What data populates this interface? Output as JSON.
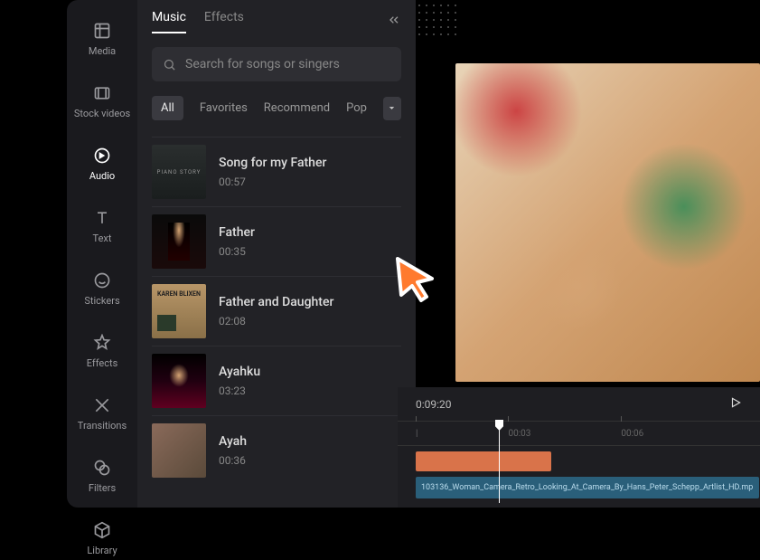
{
  "sidebar": {
    "items": [
      {
        "label": "Media"
      },
      {
        "label": "Stock videos"
      },
      {
        "label": "Audio"
      },
      {
        "label": "Text"
      },
      {
        "label": "Stickers"
      },
      {
        "label": "Effects"
      },
      {
        "label": "Transitions"
      },
      {
        "label": "Filters"
      },
      {
        "label": "Library"
      }
    ]
  },
  "panel": {
    "tabs": {
      "music": "Music",
      "effects": "Effects"
    },
    "search_placeholder": "Search for songs or singers",
    "filters": {
      "all": "All",
      "favorites": "Favorites",
      "recommend": "Recommend",
      "pop": "Pop"
    },
    "songs": [
      {
        "title": "Song for my Father",
        "duration": "00:57"
      },
      {
        "title": "Father",
        "duration": "00:35"
      },
      {
        "title": "Father and Daughter",
        "duration": "02:08"
      },
      {
        "title": "Ayahku",
        "duration": "03:23"
      },
      {
        "title": "Ayah",
        "duration": "00:36"
      }
    ]
  },
  "timeline": {
    "current": "0:09:20",
    "marks": [
      "00:03",
      "00:06"
    ],
    "clip_label": "103136_Woman_Camera_Retro_Looking_At_Camera_By_Hans_Peter_Schepp_Artlist_HD.mp"
  }
}
